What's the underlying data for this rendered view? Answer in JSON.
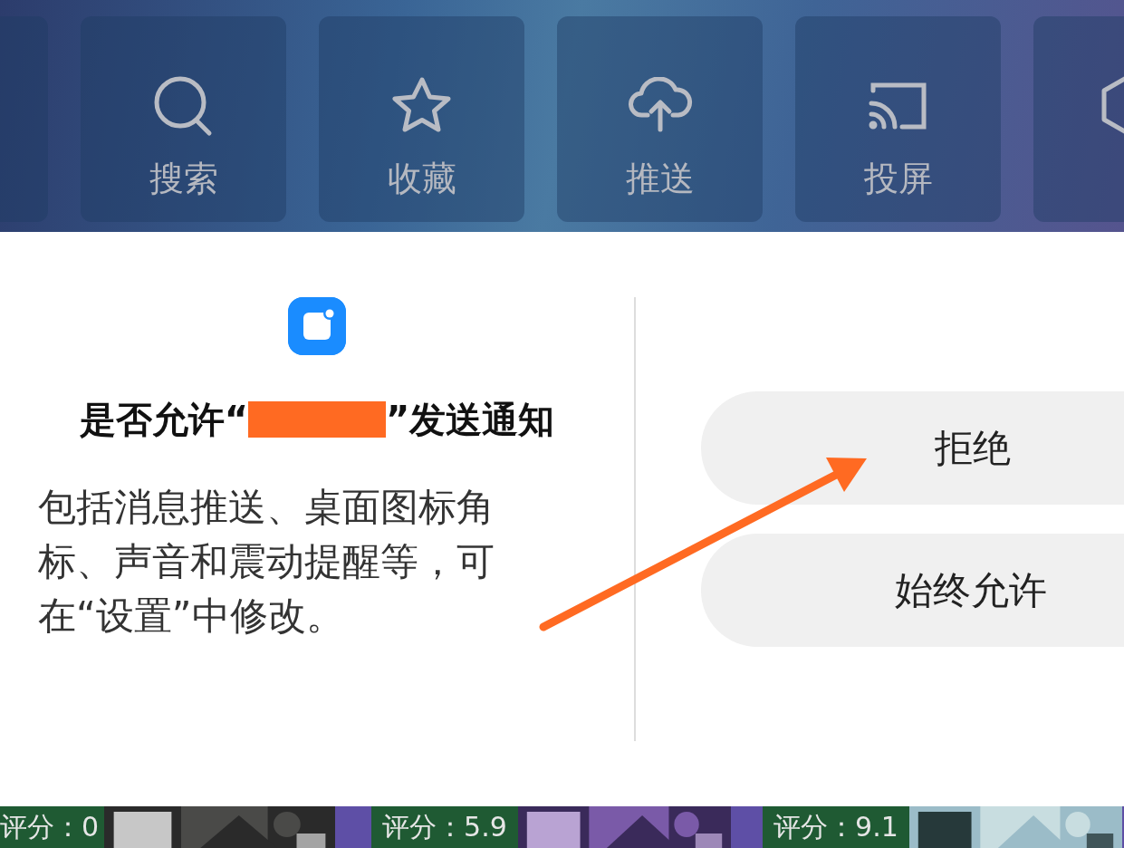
{
  "toolbar": {
    "items": [
      {
        "kind": "blank"
      },
      {
        "kind": "search",
        "label": "搜索"
      },
      {
        "kind": "star",
        "label": "收藏"
      },
      {
        "kind": "upload",
        "label": "推送"
      },
      {
        "kind": "cast",
        "label": "投屏"
      },
      {
        "kind": "settings"
      }
    ]
  },
  "dialog": {
    "title_before": "是否允许“",
    "redacted": true,
    "title_after": "”发送通知",
    "message": "包括消息推送、桌面图标角标、声音和震动提醒等，可在“设置”中修改。",
    "buttons": [
      {
        "label": "拒绝"
      },
      {
        "label": "始终允许"
      }
    ]
  },
  "cards": [
    {
      "rating": "评分：0",
      "kind": "picture"
    },
    {
      "rating": "评分：5.9",
      "kind": "picture"
    },
    {
      "rating": "评分：9.1",
      "kind": "picture"
    }
  ]
}
